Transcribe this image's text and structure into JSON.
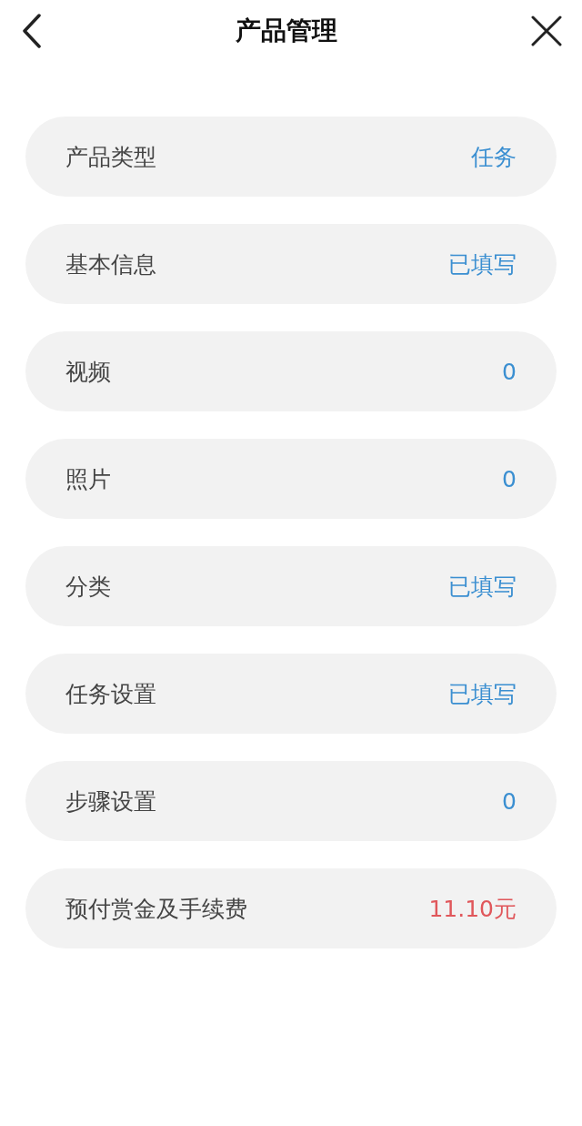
{
  "header": {
    "title": "产品管理"
  },
  "rows": [
    {
      "label": "产品类型",
      "value": "任务",
      "color": "#3b8fd1"
    },
    {
      "label": "基本信息",
      "value": "已填写",
      "color": "#3b8fd1"
    },
    {
      "label": "视频",
      "value": "0",
      "color": "#3b8fd1"
    },
    {
      "label": "照片",
      "value": "0",
      "color": "#3b8fd1"
    },
    {
      "label": "分类",
      "value": "已填写",
      "color": "#3b8fd1"
    },
    {
      "label": "任务设置",
      "value": "已填写",
      "color": "#3b8fd1"
    },
    {
      "label": "步骤设置",
      "value": "0",
      "color": "#3b8fd1"
    },
    {
      "label": "预付赏金及手续费",
      "value": "11.10元",
      "color": "#e0575b"
    }
  ]
}
